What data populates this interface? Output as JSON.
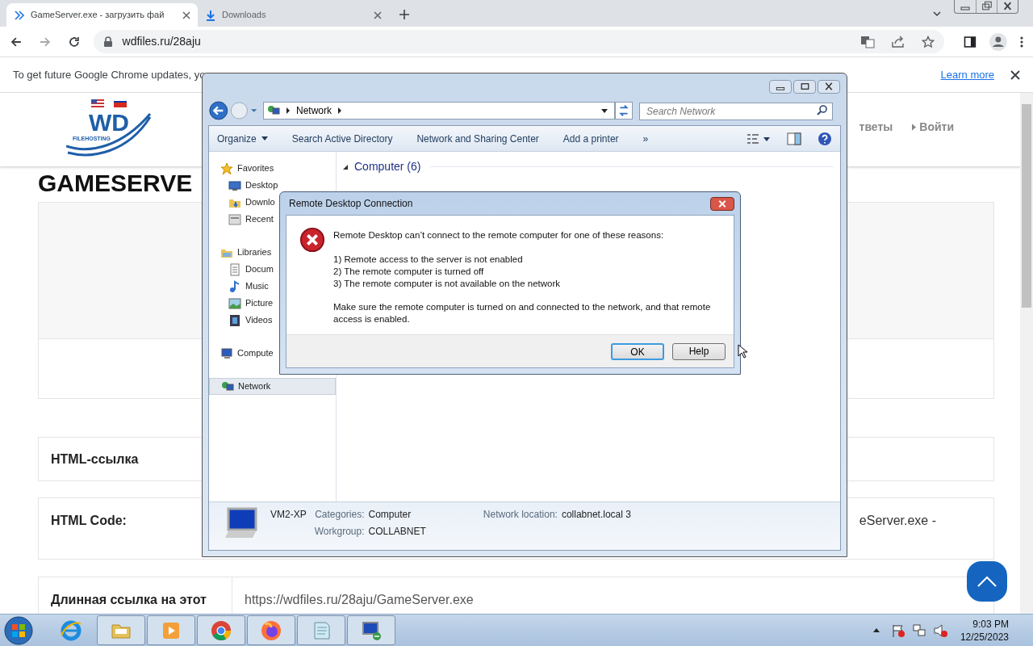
{
  "browser": {
    "tabs": [
      {
        "title": "GameServer.exe - загрузить фай",
        "kind": "site",
        "selected": true
      },
      {
        "title": "Downloads",
        "kind": "download",
        "selected": false
      }
    ],
    "url": "wdfiles.ru/28aju",
    "infobar": {
      "text": "To get future Google Chrome updates, yo",
      "link": "Learn more"
    }
  },
  "page": {
    "logo": {
      "mark": "WD",
      "tagline": "FILEHOSTING"
    },
    "nav": [
      "тветы",
      "Войти"
    ],
    "title": "GAMESERVE",
    "rows": [
      {
        "label": "HTML-ссылка"
      },
      {
        "label": "HTML Code:",
        "value": "eServer.exe -"
      },
      {
        "label": "Длинная ссылка на этот",
        "value": "https://wdfiles.ru/28aju/GameServer.exe"
      }
    ]
  },
  "explorer": {
    "breadcrumb": "Network",
    "search": {
      "placeholder": "Search Network"
    },
    "toolbar": [
      {
        "label": "Organize",
        "kind": "menu"
      },
      {
        "label": "Search Active Directory",
        "kind": "plain"
      },
      {
        "label": "Network and Sharing Center",
        "kind": "plain"
      },
      {
        "label": "Add a printer",
        "kind": "plain"
      },
      {
        "label": "»",
        "kind": "plain"
      }
    ],
    "nav": [
      {
        "label": "Favorites",
        "kind": "star",
        "selected": false,
        "children": [
          {
            "label": "Desktop",
            "kind": "desktop",
            "selected": false
          },
          {
            "label": "Downlo",
            "kind": "folder",
            "selected": false
          },
          {
            "label": "Recent",
            "kind": "recent",
            "selected": false
          }
        ]
      },
      {
        "label": "Libraries",
        "kind": "library",
        "selected": false,
        "children": [
          {
            "label": "Docum",
            "kind": "doc",
            "selected": false
          },
          {
            "label": "Music",
            "kind": "music",
            "selected": false
          },
          {
            "label": "Picture",
            "kind": "picture",
            "selected": false
          },
          {
            "label": "Videos",
            "kind": "video",
            "selected": false
          }
        ]
      },
      {
        "label": "Compute",
        "kind": "computer",
        "selected": false
      },
      {
        "label": "Network",
        "kind": "network",
        "selected": true
      }
    ],
    "group": "Computer (6)",
    "details": {
      "name": "VM2-XP",
      "fields": [
        {
          "label": "Categories:",
          "value": "Computer"
        },
        {
          "label": "Workgroup:",
          "value": "COLLABNET"
        }
      ],
      "location": {
        "label": "Network location:",
        "value": "collabnet.local 3"
      }
    }
  },
  "dialog": {
    "title": "Remote Desktop Connection",
    "message": "Remote Desktop can’t connect to the remote computer for one of these reasons:",
    "reasons": [
      "1) Remote access to the server is not enabled",
      "2) The remote computer is turned off",
      "3) The remote computer is not available on the network"
    ],
    "note": "Make sure the remote computer is turned on and connected to the network, and that remote access is enabled.",
    "buttons": [
      {
        "label": "OK",
        "default": true
      },
      {
        "label": "Help",
        "default": false
      }
    ]
  },
  "taskbar": {
    "apps": [
      {
        "kind": "ie",
        "running": false
      },
      {
        "kind": "folder",
        "running": true
      },
      {
        "kind": "media",
        "running": true
      },
      {
        "kind": "chrome",
        "running": true
      },
      {
        "kind": "firefox",
        "running": true
      },
      {
        "kind": "notepad",
        "running": true
      },
      {
        "kind": "rdp",
        "running": true
      }
    ],
    "time": "9:03 PM",
    "date": "12/25/2023"
  }
}
